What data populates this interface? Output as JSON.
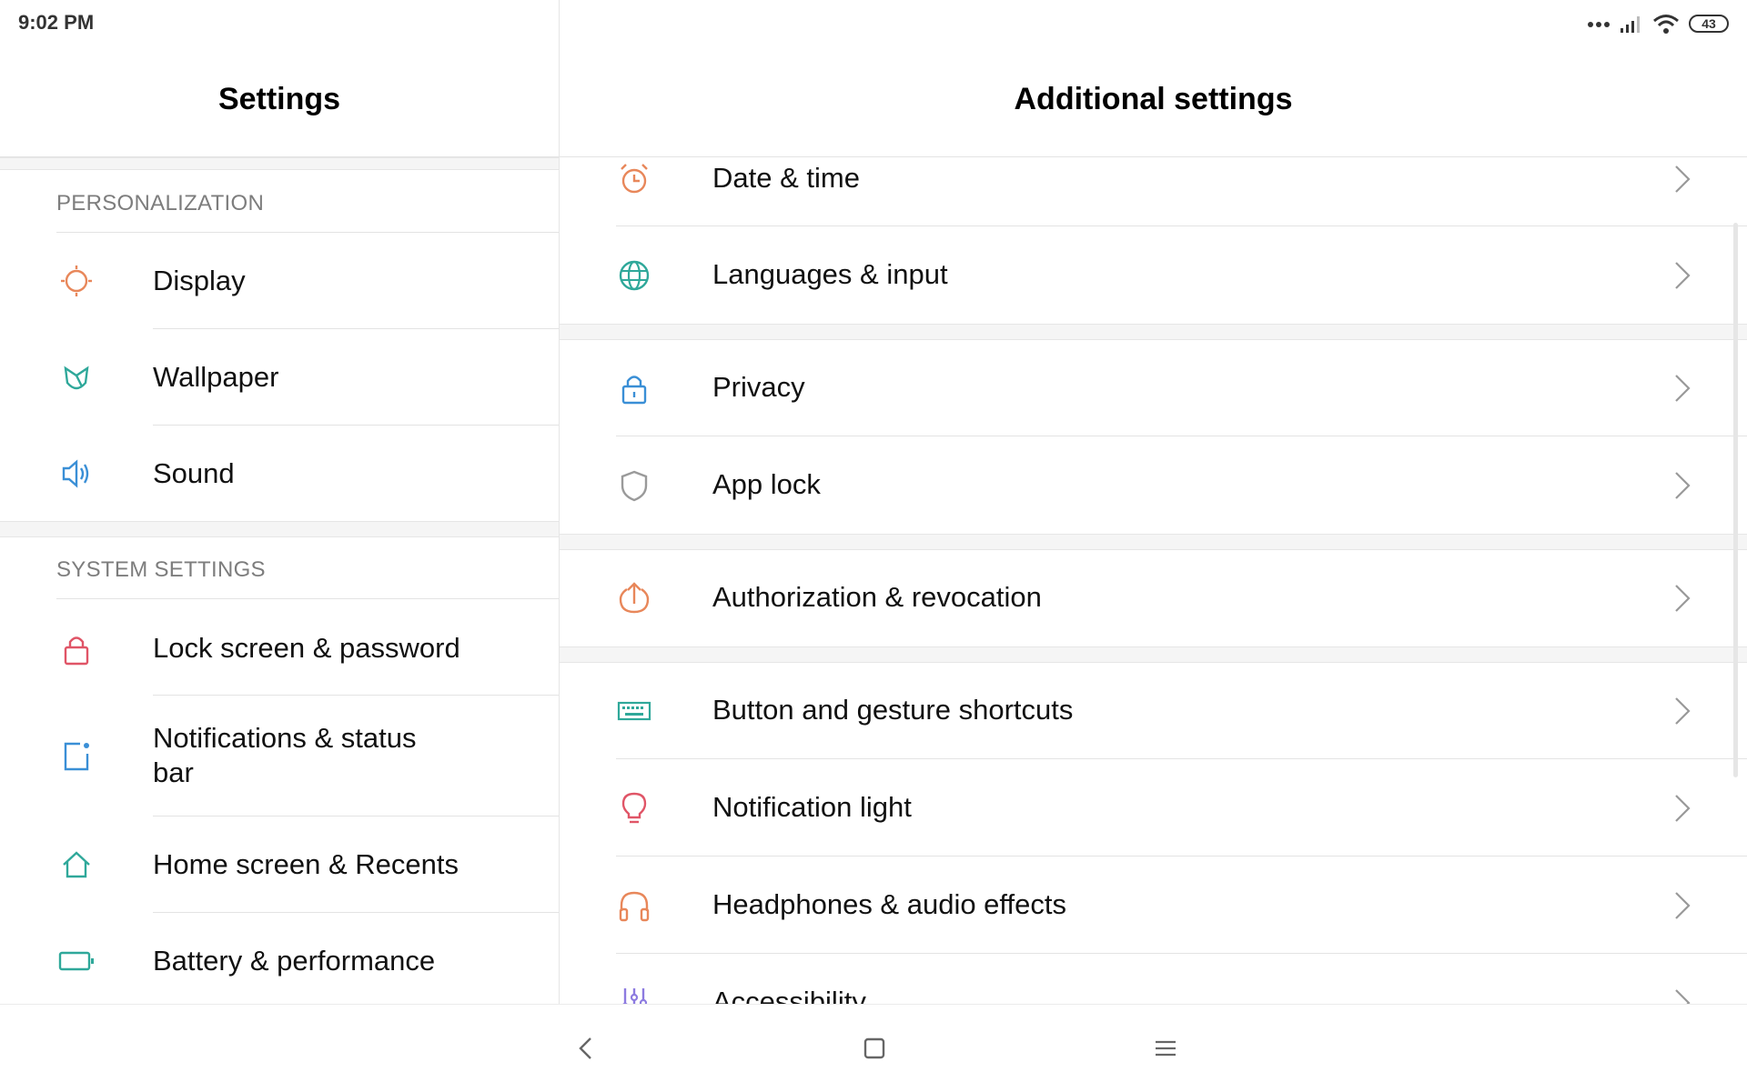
{
  "status_bar": {
    "time": "9:02 PM",
    "battery": "43"
  },
  "left_pane": {
    "title": "Settings",
    "sections": [
      {
        "title": "PERSONALIZATION",
        "items": [
          {
            "label": "Display",
            "icon": "sun-icon"
          },
          {
            "label": "Wallpaper",
            "icon": "tulip-icon"
          },
          {
            "label": "Sound",
            "icon": "speaker-icon"
          }
        ]
      },
      {
        "title": "SYSTEM SETTINGS",
        "items": [
          {
            "label": "Lock screen & password",
            "icon": "lock-icon"
          },
          {
            "label": "Notifications & status bar",
            "icon": "notification-square-icon"
          },
          {
            "label": "Home screen & Recents",
            "icon": "home-icon"
          },
          {
            "label": "Battery & performance",
            "icon": "battery-icon"
          }
        ]
      }
    ]
  },
  "right_pane": {
    "title": "Additional settings",
    "items": [
      {
        "label": "Date & time",
        "icon": "alarm-clock-icon"
      },
      {
        "label": "Languages & input",
        "icon": "globe-icon"
      },
      {
        "label": "Privacy",
        "icon": "lock-icon"
      },
      {
        "label": "App lock",
        "icon": "shield-icon"
      },
      {
        "label": "Authorization & revocation",
        "icon": "upload-circle-icon"
      },
      {
        "label": "Button and gesture shortcuts",
        "icon": "keyboard-icon"
      },
      {
        "label": "Notification light",
        "icon": "lightbulb-icon"
      },
      {
        "label": "Headphones & audio effects",
        "icon": "headphones-icon"
      },
      {
        "label": "Accessibility",
        "icon": "sliders-icon"
      }
    ]
  },
  "colors": {
    "orange": "#e8875a",
    "teal": "#2fa89a",
    "blue": "#3a8fd6",
    "red": "#e05567",
    "gray": "#9a9a9a",
    "purple": "#8d7be0"
  },
  "nav_bar": {
    "back": "back-icon",
    "home": "home-square-icon",
    "menu": "menu-icon"
  }
}
